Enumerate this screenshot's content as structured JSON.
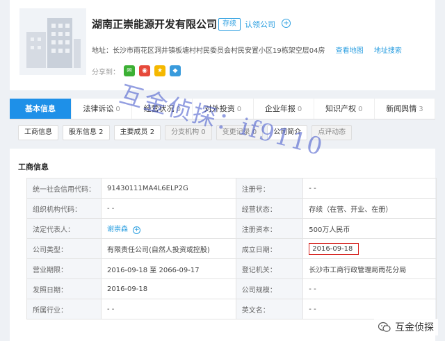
{
  "company": {
    "name": "湖南正崇能源开发有限公司",
    "status": "存续",
    "claim": "认领公司",
    "address_label": "地址：",
    "address": "长沙市雨花区洞井镇板塘村村民委员会村民安置小区19栋架空层04房",
    "map_link": "查看地图",
    "addr_search": "地址搜索",
    "share_label": "分享到："
  },
  "tabs": [
    {
      "label": "基本信息",
      "count": ""
    },
    {
      "label": "法律诉讼",
      "count": "0"
    },
    {
      "label": "经营状况",
      "count": "0"
    },
    {
      "label": "对外投资",
      "count": "0"
    },
    {
      "label": "企业年报",
      "count": "0"
    },
    {
      "label": "知识产权",
      "count": "0"
    },
    {
      "label": "新闻舆情",
      "count": "3"
    }
  ],
  "subtabs": [
    "工商信息",
    "股东信息 2",
    "主要成员 2",
    "分支机构 0",
    "变更记录 0",
    "公司简介",
    "点评动态"
  ],
  "section_title": "工商信息",
  "rows": [
    {
      "l1": "统一社会信用代码：",
      "v1": "91430111MA4L6ELP2G",
      "l2": "注册号：",
      "v2": "- -"
    },
    {
      "l1": "组织机构代码：",
      "v1": "- -",
      "l2": "经营状态：",
      "v2": "存续（在营、开业、在册）"
    },
    {
      "l1": "法定代表人：",
      "v1": "谢崇森",
      "l2": "注册资本：",
      "v2": "500万人民币"
    },
    {
      "l1": "公司类型：",
      "v1": "有限责任公司(自然人投资或控股)",
      "l2": "成立日期：",
      "v2": "2016-09-18"
    },
    {
      "l1": "营业期限：",
      "v1": "2016-09-18 至 2066-09-17",
      "l2": "登记机关：",
      "v2": "长沙市工商行政管理局雨花分局"
    },
    {
      "l1": "发照日期：",
      "v1": "2016-09-18",
      "l2": "公司规模：",
      "v2": "- -"
    },
    {
      "l1": "所属行业：",
      "v1": "- -",
      "l2": "英文名：",
      "v2": "- -"
    }
  ],
  "watermark": "互金侦探：if9110",
  "wechat_label": "互金侦探",
  "colors": {
    "accent": "#1e90e8",
    "highlight": "#d6221f"
  }
}
